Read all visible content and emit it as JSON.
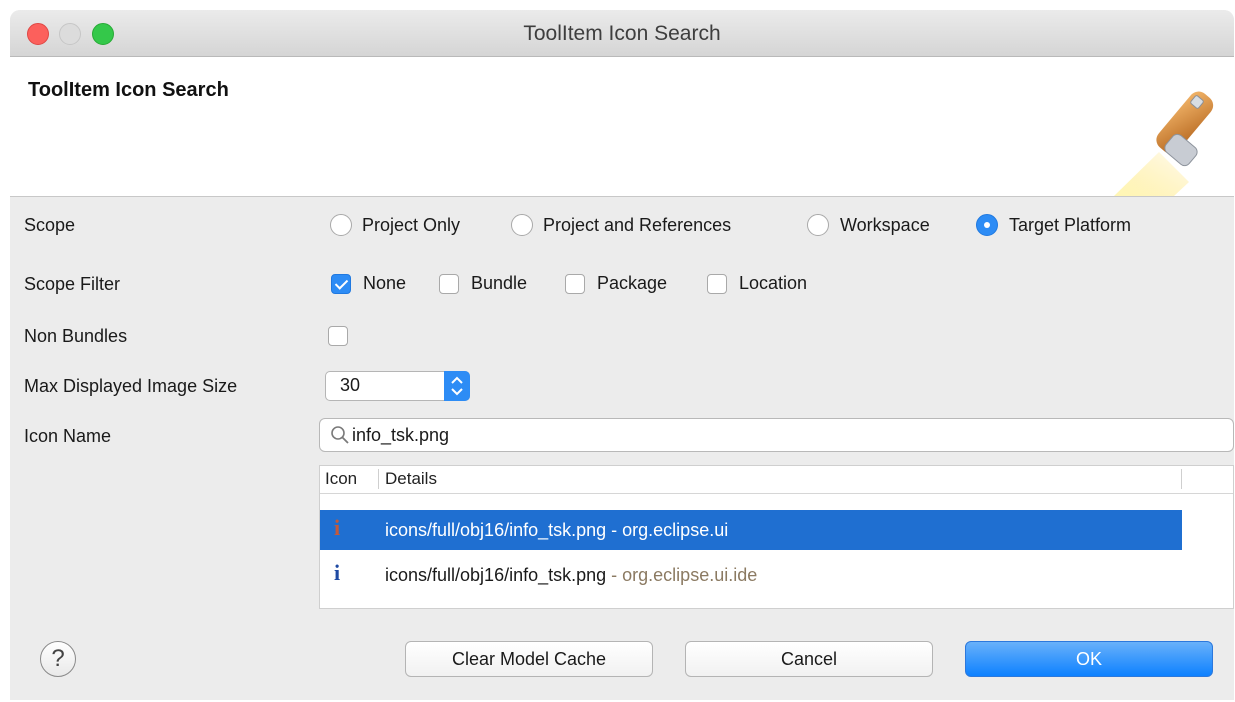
{
  "window": {
    "title": "ToolItem Icon Search"
  },
  "banner": {
    "title": "ToolItem Icon Search",
    "art_icon": "flashlight-icon"
  },
  "form": {
    "scope": {
      "label": "Scope",
      "options": [
        {
          "label": "Project Only",
          "selected": false
        },
        {
          "label": "Project and References",
          "selected": false
        },
        {
          "label": "Workspace",
          "selected": false
        },
        {
          "label": "Target Platform",
          "selected": true
        }
      ]
    },
    "scope_filter": {
      "label": "Scope Filter",
      "options": [
        {
          "label": "None",
          "checked": true
        },
        {
          "label": "Bundle",
          "checked": false
        },
        {
          "label": "Package",
          "checked": false
        },
        {
          "label": "Location",
          "checked": false
        }
      ]
    },
    "non_bundles": {
      "label": "Non Bundles",
      "checked": false
    },
    "max_size": {
      "label": "Max Displayed Image Size",
      "value": "30"
    },
    "icon_name": {
      "label": "Icon Name",
      "value": "info_tsk.png"
    }
  },
  "results": {
    "headers": [
      "Icon",
      "Details"
    ],
    "rows": [
      {
        "icon": "info-icon",
        "path": "icons/full/obj16/info_tsk.png",
        "plugin": " - org.eclipse.ui",
        "selected": true
      },
      {
        "icon": "info-icon",
        "path": "icons/full/obj16/info_tsk.png",
        "plugin": " - org.eclipse.ui.ide",
        "selected": false
      }
    ]
  },
  "buttons": {
    "help": "?",
    "clear_cache": "Clear Model Cache",
    "cancel": "Cancel",
    "ok": "OK"
  },
  "colors": {
    "accent": "#2d8cf5",
    "selection": "#1f6fd1",
    "secondary_text": "#8b7a62"
  }
}
